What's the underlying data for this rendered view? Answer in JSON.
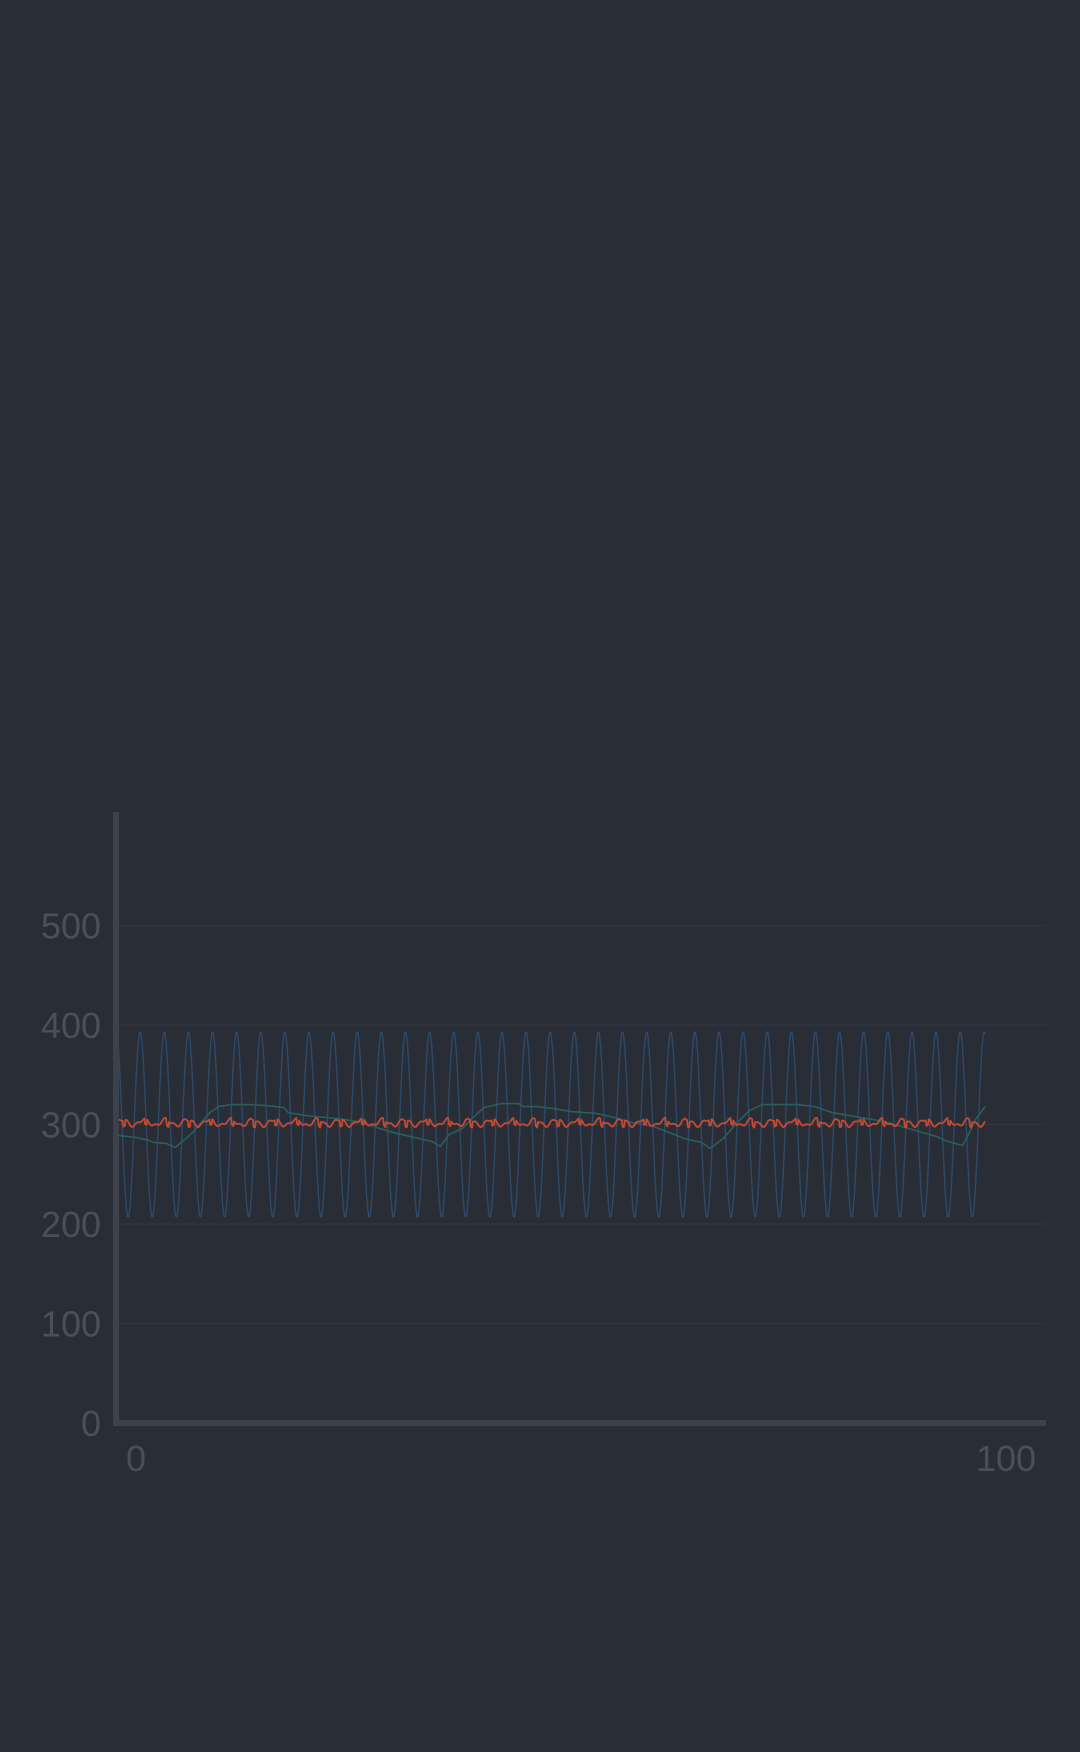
{
  "colors": {
    "background": "#292d35",
    "axis": "#3c414b",
    "grid": "#31353e",
    "tick_text": "#4a4f5a"
  },
  "chart_data": {
    "type": "line",
    "title": "",
    "xlabel": "",
    "ylabel": "",
    "xlim": [
      0,
      100
    ],
    "ylim": [
      0,
      610
    ],
    "grid": true,
    "legend": "none",
    "x_ticks": [
      {
        "value": 0,
        "label": "0"
      },
      {
        "value": 100,
        "label": "100"
      }
    ],
    "y_ticks": [
      {
        "value": 0,
        "label": "0"
      },
      {
        "value": 100,
        "label": "100"
      },
      {
        "value": 200,
        "label": "200"
      },
      {
        "value": 300,
        "label": "300"
      },
      {
        "value": 400,
        "label": "400"
      },
      {
        "value": 500,
        "label": "500"
      }
    ],
    "x_range_drawn": [
      -2.2,
      97.6
    ],
    "series": [
      {
        "color": "#2e4a6b",
        "kind": "sine",
        "center": 300,
        "amplitude": 93,
        "cycles": 36,
        "phase_deg": 12
      },
      {
        "color": "#2a5e5b",
        "kind": "sawtooth",
        "points": [
          [
            -2.2,
            289
          ],
          [
            0.0,
            287
          ],
          [
            1.5,
            284
          ],
          [
            2.0,
            282
          ],
          [
            3.5,
            281
          ],
          [
            4.5,
            277
          ],
          [
            5.5,
            284
          ],
          [
            6.5,
            292
          ],
          [
            7.5,
            302
          ],
          [
            8.5,
            312
          ],
          [
            9.5,
            318
          ],
          [
            11.0,
            320
          ],
          [
            13.0,
            320
          ],
          [
            15.0,
            319
          ],
          [
            17.0,
            317
          ],
          [
            17.5,
            312
          ],
          [
            19.5,
            309
          ],
          [
            22.0,
            307
          ],
          [
            24.0,
            305
          ],
          [
            26.0,
            302
          ],
          [
            28.0,
            296
          ],
          [
            30.0,
            291
          ],
          [
            32.0,
            287
          ],
          [
            34.0,
            283
          ],
          [
            35.0,
            278
          ],
          [
            36.0,
            290
          ],
          [
            37.5,
            296
          ],
          [
            38.5,
            305
          ],
          [
            40.0,
            317
          ],
          [
            42.0,
            321
          ],
          [
            44.0,
            321
          ],
          [
            44.5,
            318
          ],
          [
            46.0,
            318
          ],
          [
            48.0,
            316
          ],
          [
            50.0,
            313
          ],
          [
            53.0,
            311
          ],
          [
            55.0,
            307
          ],
          [
            57.0,
            302
          ],
          [
            59.5,
            298
          ],
          [
            61.0,
            293
          ],
          [
            63.0,
            286
          ],
          [
            65.0,
            282
          ],
          [
            66.0,
            276
          ],
          [
            67.5,
            286
          ],
          [
            69.0,
            301
          ],
          [
            70.5,
            314
          ],
          [
            72.0,
            320
          ],
          [
            74.0,
            320
          ],
          [
            76.0,
            320
          ],
          [
            78.0,
            318
          ],
          [
            80.0,
            312
          ],
          [
            82.0,
            309
          ],
          [
            84.0,
            306
          ],
          [
            86.0,
            303
          ],
          [
            88.0,
            298
          ],
          [
            90.0,
            293
          ],
          [
            92.0,
            288
          ],
          [
            93.0,
            284
          ],
          [
            94.5,
            280
          ],
          [
            95.0,
            279
          ],
          [
            95.7,
            290
          ],
          [
            96.5,
            305
          ],
          [
            97.6,
            318
          ]
        ]
      },
      {
        "color": "#c44a34",
        "kind": "noisy",
        "center": 302,
        "amplitude": 4,
        "cycles": 40,
        "dip_depth": 6
      }
    ]
  }
}
